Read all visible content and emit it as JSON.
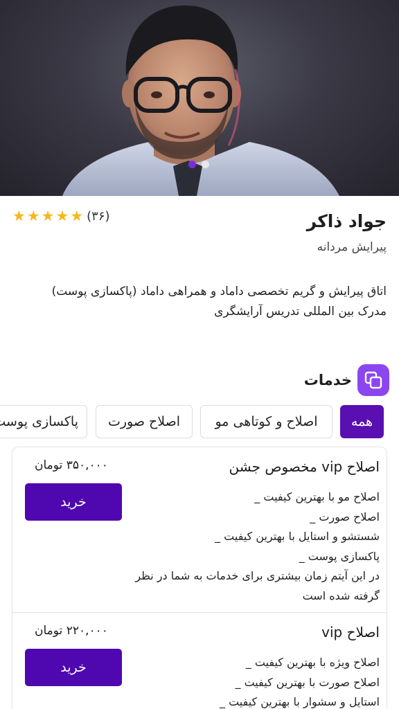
{
  "hero": {
    "photo_icon": "man-portrait-photo",
    "carousel_dots": 2,
    "active_dot": 0
  },
  "profile": {
    "name": "جواد ذاکر",
    "category": "پیرایش مردانه",
    "rating": {
      "stars": 5,
      "count_label": "(۳۶)"
    },
    "bio_lines": [
      "اتاق پیرایش و گریم تخصصی داماد و همراهی داماد (پاکسازی پوست)",
      "مدرک بین المللی تدریس آرایشگری"
    ]
  },
  "services": {
    "title": "خدمات",
    "icon": "copy-icon",
    "tabs": [
      "همه",
      "اصلاح و کوتاهی مو",
      "اصلاح صورت",
      "پاکسازی پوست"
    ],
    "active_tab": 0,
    "items": [
      {
        "title": "اصلاح vip مخصوص جشن",
        "price": "۳۵۰,۰۰۰ تومان",
        "buy_label": "خرید",
        "desc_lines": [
          "اصلاح مو با بهترین کیفیت _",
          "اصلاح صورت _",
          "شستشو و استایل با بهترین کیفیت _",
          "پاکسازی پوست _",
          "در این آیتم زمان بیشتری برای خدمات به  شما در نظر گرفته شده است"
        ]
      },
      {
        "title": "اصلاح vip",
        "price": "۲۲۰,۰۰۰ تومان",
        "buy_label": "خرید",
        "desc_lines": [
          "اصلاح ویژه با بهترین کیفیت _",
          "اصلاح صورت با بهترین کیفیت _",
          "استایل و سشوار با بهترین کیفیت _"
        ]
      }
    ]
  },
  "colors": {
    "accent": "#5a0fb3",
    "accent_light": "#8b46f0",
    "star": "#f5b81c",
    "dot_active": "#7a2be0"
  }
}
